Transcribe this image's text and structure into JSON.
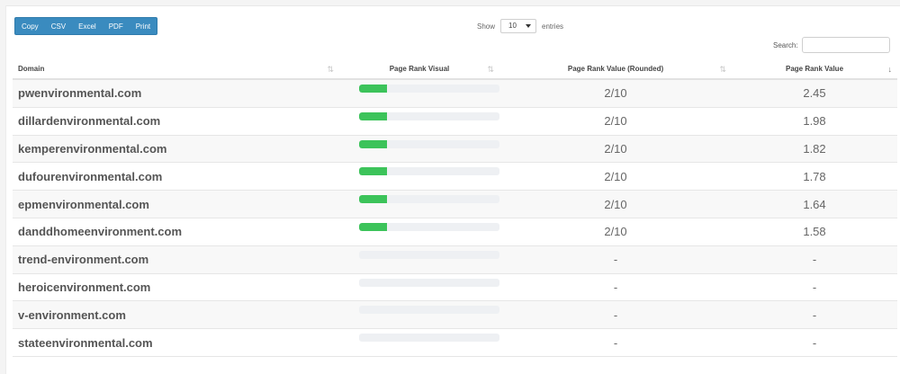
{
  "toolbar": {
    "buttons": [
      "Copy",
      "CSV",
      "Excel",
      "PDF",
      "Print"
    ]
  },
  "length": {
    "show_label": "Show",
    "value": "10",
    "entries_label": "entries"
  },
  "search": {
    "label": "Search:",
    "value": ""
  },
  "table": {
    "columns": [
      "Domain",
      "Page Rank Visual",
      "Page Rank Value (Rounded)",
      "Page Rank Value"
    ],
    "sort_icons": {
      "inactive": "⇅",
      "active_desc": "↓"
    },
    "rows": [
      {
        "domain": "pwenvironmental.com",
        "rank_fraction": 0.2,
        "rounded": "2/10",
        "value": "2.45"
      },
      {
        "domain": "dillardenvironmental.com",
        "rank_fraction": 0.2,
        "rounded": "2/10",
        "value": "1.98"
      },
      {
        "domain": "kemperenvironmental.com",
        "rank_fraction": 0.2,
        "rounded": "2/10",
        "value": "1.82"
      },
      {
        "domain": "dufourenvironmental.com",
        "rank_fraction": 0.2,
        "rounded": "2/10",
        "value": "1.78"
      },
      {
        "domain": "epmenvironmental.com",
        "rank_fraction": 0.2,
        "rounded": "2/10",
        "value": "1.64"
      },
      {
        "domain": "danddhomeenvironment.com",
        "rank_fraction": 0.2,
        "rounded": "2/10",
        "value": "1.58"
      },
      {
        "domain": "trend-environment.com",
        "rank_fraction": 0,
        "rounded": "-",
        "value": "-"
      },
      {
        "domain": "heroicenvironment.com",
        "rank_fraction": 0,
        "rounded": "-",
        "value": "-"
      },
      {
        "domain": "v-environment.com",
        "rank_fraction": 0,
        "rounded": "-",
        "value": "-"
      },
      {
        "domain": "stateenvironmental.com",
        "rank_fraction": 0,
        "rounded": "-",
        "value": "-"
      }
    ]
  },
  "colors": {
    "button_bg": "#3a8bbf",
    "bar_fill": "#3cc35a",
    "bar_track": "#eef0f3"
  }
}
